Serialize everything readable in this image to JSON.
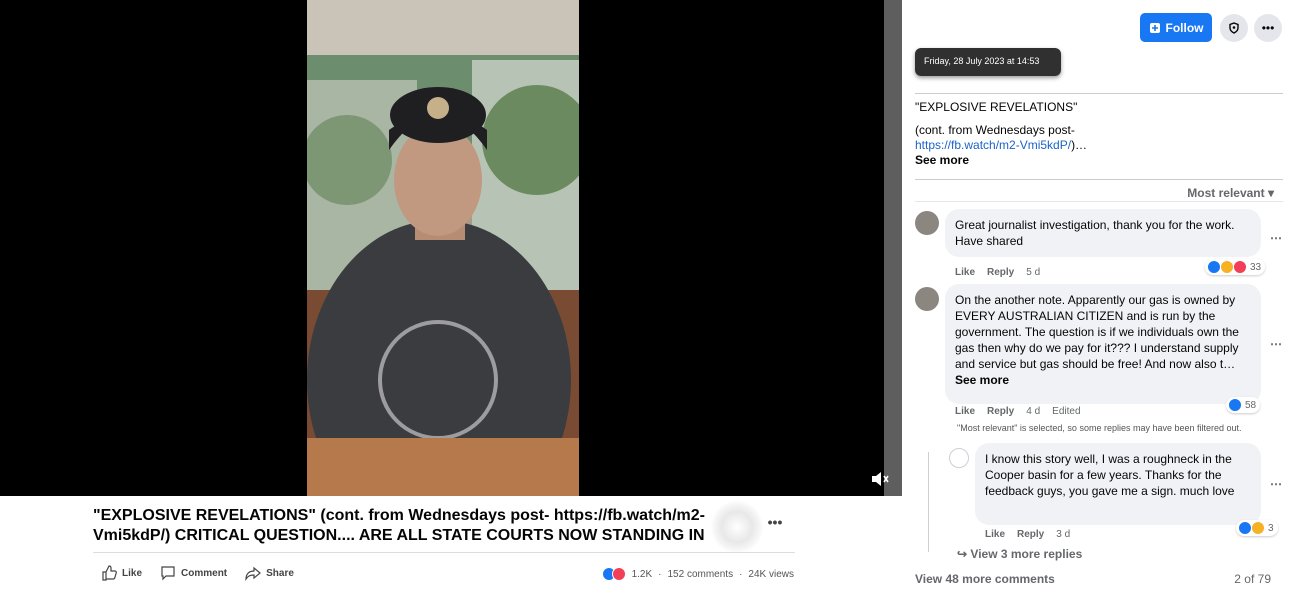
{
  "video": {
    "caption": "\"EXPLOSIVE REVELATIONS\" (cont. from Wednesdays post- https://fb.watch/m2-Vmi5kdP/) CRITICAL QUESTION.... ARE ALL STATE COURTS NOW STANDING IN LEGA...",
    "more_label": "•••",
    "mute_icon": "volume-icon"
  },
  "actions": {
    "like": "Like",
    "comment": "Comment",
    "share": "Share"
  },
  "stats": {
    "reactions": "1.2K",
    "comments": "152 comments",
    "views": "24K views",
    "separator": "·"
  },
  "panel": {
    "follow_label": "Follow",
    "more_label": "•••",
    "tooltip": "Friday, 28 July 2023 at 14:53",
    "post_title": "\"EXPLOSIVE REVELATIONS\"",
    "post_body_prefix": "(cont. from Wednesdays post-",
    "post_link": "https://fb.watch/m2-Vmi5kdP/",
    "post_link_suffix": ")…",
    "post_see_more": "See more",
    "sort_label": "Most relevant"
  },
  "comments": [
    {
      "text": "Great journalist investigation, thank you for the work. Have shared",
      "like": "Like",
      "reply": "Reply",
      "time": "5 d",
      "reactions": "33"
    },
    {
      "text": "On the another note. Apparently our gas is owned by EVERY AUSTRALIAN CITIZEN and is run by the government. The question is if we individuals own the gas then why do we pay for it??? I understand supply and service but gas should be free! And now also t…",
      "see_more": "See more",
      "like": "Like",
      "reply": "Reply",
      "time": "4 d",
      "edited": "Edited",
      "reactions": "58"
    },
    {
      "text": "I know this story well, I was a roughneck in the Cooper basin for a few years. Thanks for the feedback guys, you gave me a sign. much love",
      "like": "Like",
      "reply": "Reply",
      "time": "3 d",
      "reactions": "3"
    }
  ],
  "filter_note": "\"Most relevant\" is selected, so some replies may have been filtered out.",
  "more_replies": "View 3 more replies",
  "view_more_comments": "View 48 more comments",
  "pager": "2 of 79",
  "colors": {
    "accent": "#1877f2",
    "like": "#1877f2",
    "love": "#f33e58",
    "haha": "#f7b125"
  }
}
